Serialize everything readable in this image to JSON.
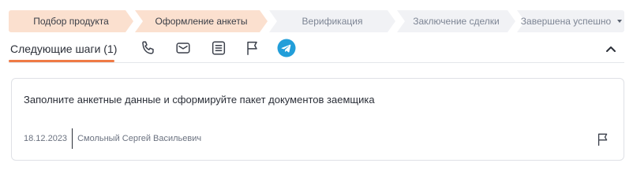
{
  "stages": [
    {
      "label": "Подбор продукта",
      "status": "done"
    },
    {
      "label": "Оформление анкеты",
      "status": "done"
    },
    {
      "label": "Верификация",
      "status": "todo"
    },
    {
      "label": "Заключение сделки",
      "status": "todo"
    },
    {
      "label": "Завершена успешно",
      "status": "todo"
    }
  ],
  "tabs": {
    "next_steps_label": "Следующие шаги (1)",
    "icons": [
      "phone-icon",
      "mail-icon",
      "document-icon",
      "flag-icon",
      "telegram-icon"
    ]
  },
  "task": {
    "text": "Заполните анкетные данные и сформируйте пакет документов заемщика",
    "date": "18.12.2023",
    "author": "Смольный Сергей Васильевич"
  },
  "colors": {
    "accent": "#ef7a45",
    "stage_done_bg": "#fbe0cf",
    "stage_todo_bg": "#f1f2f5",
    "telegram": "#229ed9"
  }
}
